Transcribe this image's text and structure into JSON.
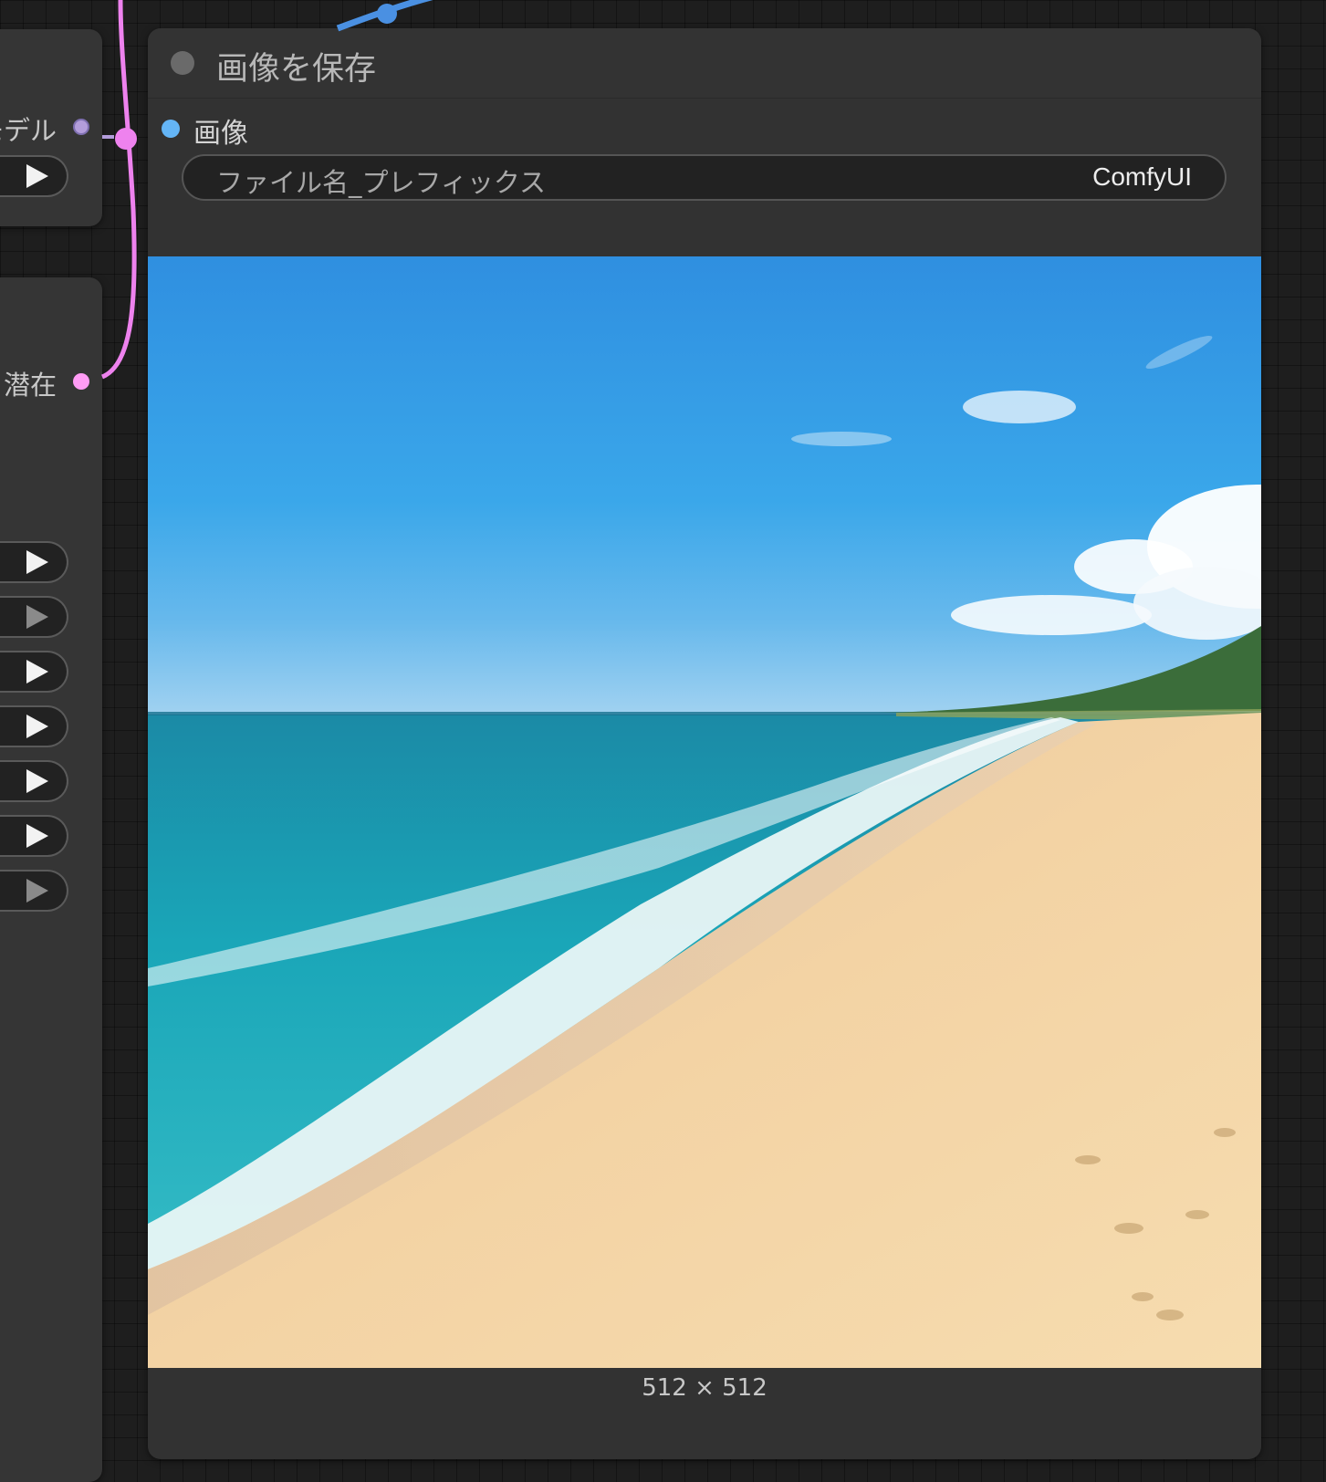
{
  "left_nodes": {
    "model_output_label": "モデル",
    "latent_output_label": "潜在"
  },
  "save_node": {
    "title": "画像を保存",
    "input_label": "画像",
    "widget": {
      "label": "ファイル名_プレフィックス",
      "value": "ComfyUI"
    },
    "image_caption": "512 × 512"
  },
  "colors": {
    "canvas": "#1e1e1e",
    "node_body": "#353535",
    "model_port": "#b39ddb",
    "latent_port": "#ff9cf5",
    "image_port": "#64b5f6",
    "latent_wire": "#ee82ee",
    "image_wire": "#4a90e2"
  },
  "icons": [
    "play-icon",
    "status-dot-icon"
  ]
}
